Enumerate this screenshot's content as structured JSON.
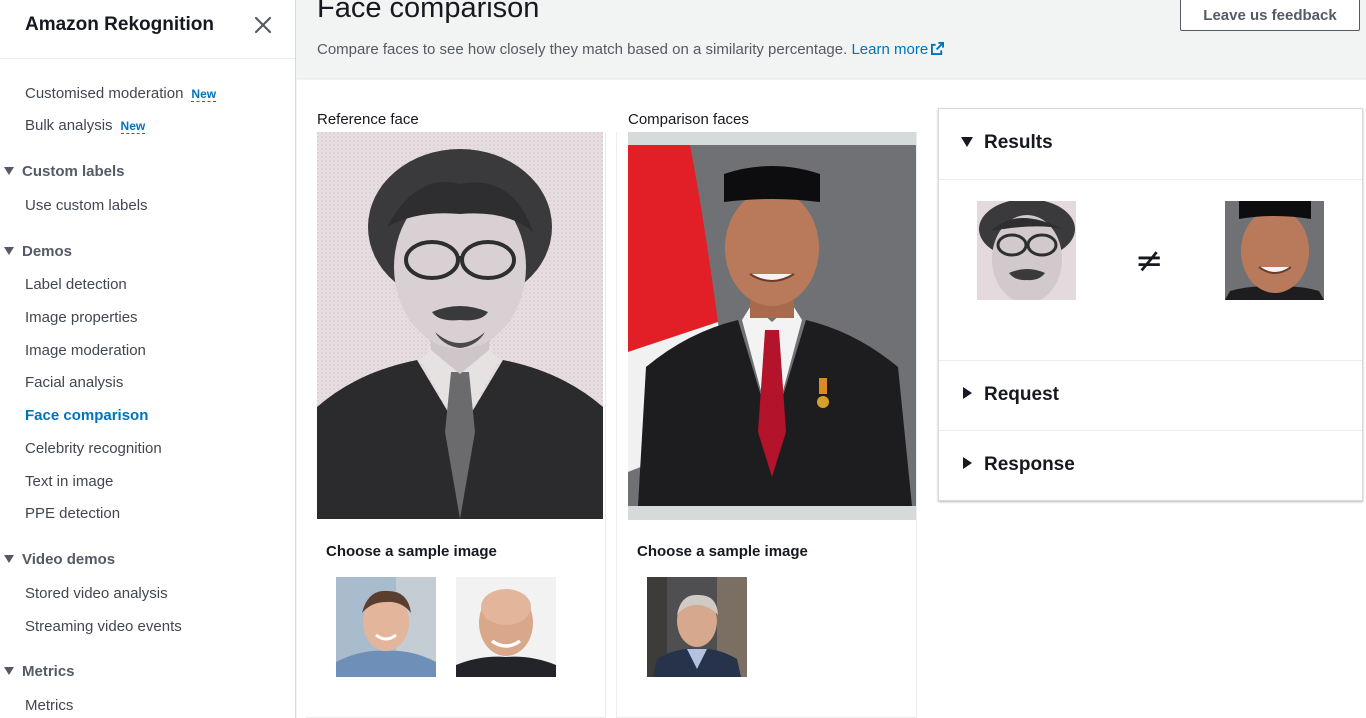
{
  "sidebar": {
    "title": "Amazon Rekognition",
    "items_top": [
      {
        "label": "Customised moderation",
        "badge": "New"
      },
      {
        "label": "Bulk analysis",
        "badge": "New"
      }
    ],
    "section_custom_labels": "Custom labels",
    "use_custom_labels": "Use custom labels",
    "section_demos": "Demos",
    "demos": [
      "Label detection",
      "Image properties",
      "Image moderation",
      "Facial analysis",
      "Face comparison",
      "Celebrity recognition",
      "Text in image",
      "PPE detection"
    ],
    "active_item": "Face comparison",
    "section_video_demos": "Video demos",
    "video_demos": [
      "Stored video analysis",
      "Streaming video events"
    ],
    "section_metrics": "Metrics",
    "metrics": [
      "Metrics"
    ]
  },
  "header": {
    "title": "Face comparison",
    "description": "Compare faces to see how closely they match based on a similarity percentage.",
    "learn_more": "Learn more",
    "feedback_button": "Leave us feedback"
  },
  "reference": {
    "label": "Reference face",
    "sample_title": "Choose a sample image",
    "samples": [
      "sample-man-smiling",
      "sample-bald-man"
    ]
  },
  "comparison": {
    "label": "Comparison faces",
    "sample_title": "Choose a sample image",
    "samples": [
      "sample-man-suit"
    ]
  },
  "results": {
    "title": "Results",
    "match_symbol": "≠",
    "request_title": "Request",
    "response_title": "Response"
  },
  "colors": {
    "accent": "#0073bb",
    "text": "#16191f",
    "muted": "#545b64",
    "border": "#eaeded"
  }
}
